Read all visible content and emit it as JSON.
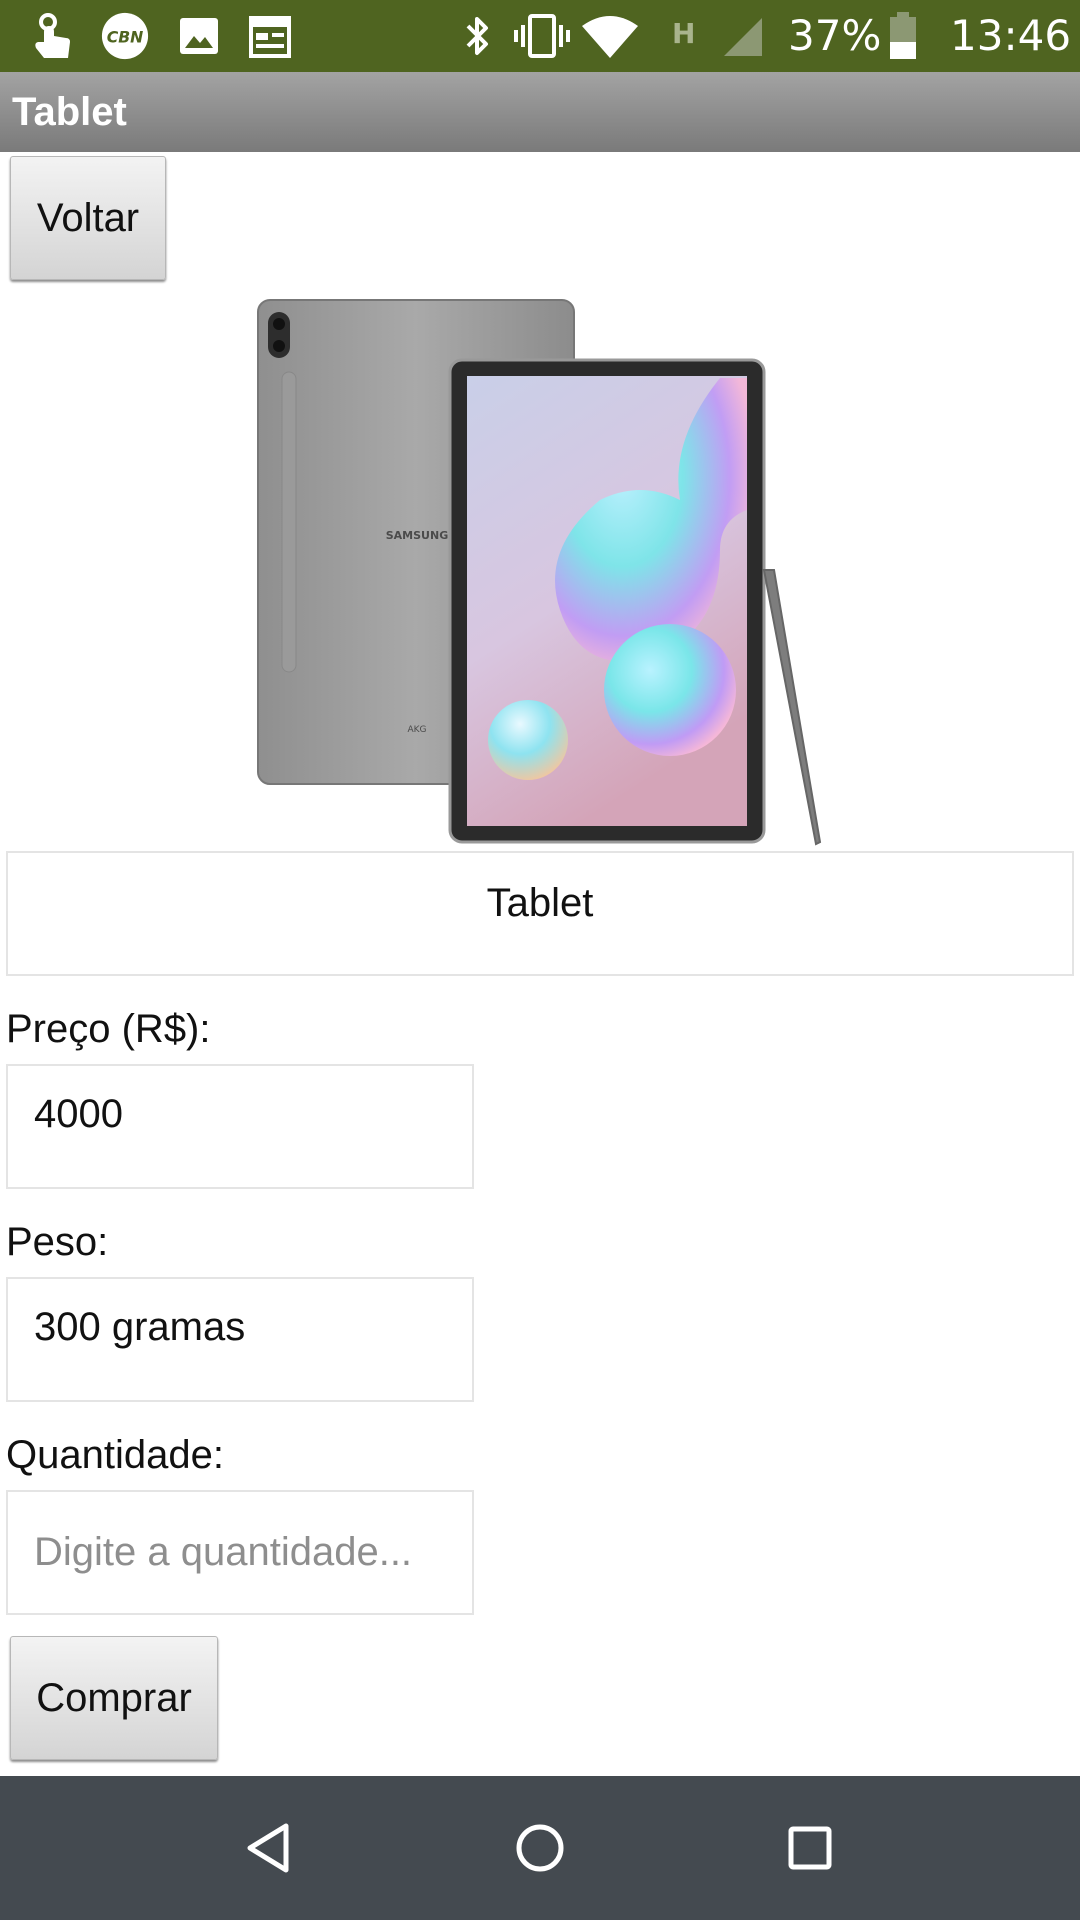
{
  "status_bar": {
    "battery": "37%",
    "time": "13:46",
    "network_type": "H",
    "icons": [
      "touch-icon",
      "cbn-icon",
      "image-icon",
      "calendar-icon",
      "bluetooth-icon",
      "vibrate-icon",
      "wifi-icon",
      "signal-icon",
      "battery-icon"
    ],
    "cbn_label": "CBN",
    "background": "#4f6420"
  },
  "app_bar": {
    "title": "Tablet"
  },
  "back_button": {
    "label": "Voltar"
  },
  "product": {
    "name": "Tablet",
    "image_brand": "SAMSUNG",
    "image_audio_brand": "AKG"
  },
  "price": {
    "label": "Preço (R$):",
    "value": "4000"
  },
  "weight": {
    "label": "Peso:",
    "value": "300 gramas"
  },
  "quantity": {
    "label": "Quantidade:",
    "value": "",
    "placeholder": "Digite a quantidade..."
  },
  "buy_button": {
    "label": "Comprar"
  },
  "nav_bar": {
    "icons": [
      "back-icon",
      "home-icon",
      "recents-icon"
    ],
    "background": "#444a50"
  }
}
